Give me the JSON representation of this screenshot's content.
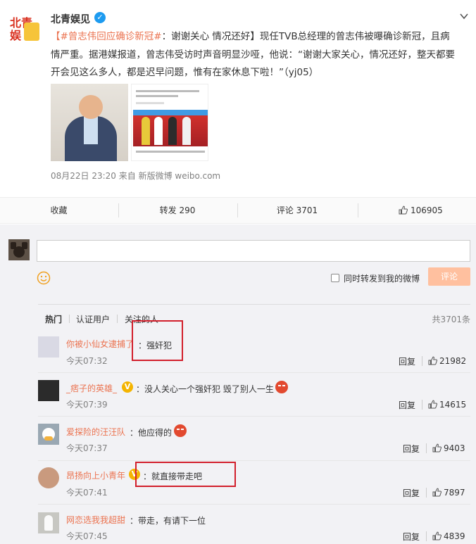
{
  "post": {
    "author": "北青娱见",
    "logo_text": "北青娱",
    "topic": "【#曾志伟回应确诊新冠#",
    "body": "：谢谢关心 情况还好】现任TVB总经理的曾志伟被曝确诊新冠，且病情严重。据港媒报道，曾志伟受访时声音明显沙哑，他说：“谢谢大家关心，情况还好，整天都要开会见这么多人，都是迟早问题，惟有在家休息下啦！”（yj05）",
    "meta": "08月22日 23:20  来自 新版微博 weibo.com"
  },
  "actions": {
    "favorite": "收藏",
    "repost": "转发 290",
    "comment": "评论 3701",
    "like": "106905"
  },
  "composer": {
    "repost_label": "同时转发到我的微博",
    "submit_label": "评论"
  },
  "filters": {
    "hot": "热门",
    "verified": "认证用户",
    "following": "关注的人",
    "total": "共3701条"
  },
  "comments": [
    {
      "name": "你被小仙女逮捕了",
      "text": "：强奸犯",
      "time": "今天07:32",
      "reply": "回复",
      "likes": "21982"
    },
    {
      "name": "_痞子的英雄_",
      "text": "：没人关心一个强奸犯 毁了别人一生",
      "time": "今天07:39",
      "reply": "回复",
      "likes": "14615"
    },
    {
      "name": "爱探险的汪汪队",
      "text": "：他应得的",
      "time": "今天07:37",
      "reply": "回复",
      "likes": "9403"
    },
    {
      "name": "昂扬向上小青年",
      "text": "：就直接带走吧",
      "time": "今天07:41",
      "reply": "回复",
      "likes": "7897"
    },
    {
      "name": "网恋选我我超甜",
      "text": "：带走，有请下一位",
      "time": "今天07:45",
      "reply": "回复",
      "likes": "4839"
    }
  ],
  "colors": {
    "accent": "#eb7350",
    "highlight_box": "#d21f2b",
    "verified_blue": "#1d9bf0",
    "badge_gold": "#f4b400"
  }
}
